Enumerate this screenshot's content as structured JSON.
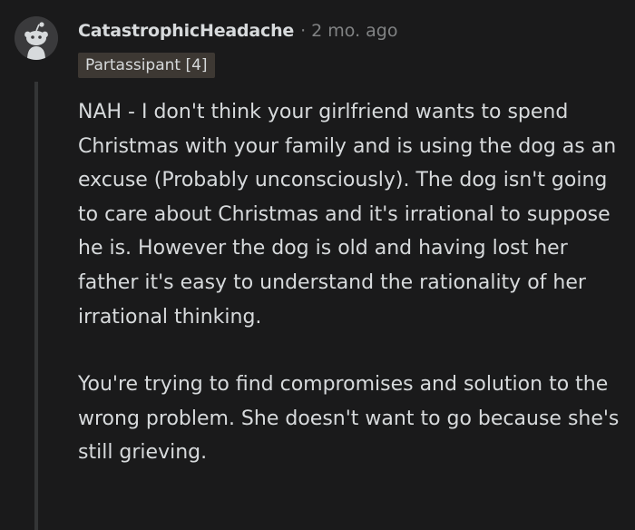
{
  "comment": {
    "username": "CatastrophicHeadache",
    "separator": "·",
    "timestamp": "2 mo. ago",
    "flair": "Partassipant [4]",
    "avatar_icon": "snoo-avatar-icon",
    "paragraphs": [
      "NAH - I don't think your girlfriend wants to spend Christmas with your family and is using the dog as an excuse (Probably unconsciously). The dog isn't going to care about Christmas and it's irrational to suppose he is. However the dog is old and having lost her father it's easy to understand the rationality of her irrational thinking.",
      "You're trying to find compromises and solution to the wrong problem. She doesn't want to go because she's still grieving."
    ]
  },
  "colors": {
    "background": "#1a1a1b",
    "text": "#d7dadc",
    "meta": "#818384",
    "flair_bg": "#3d3833",
    "thread_line": "#343536"
  }
}
